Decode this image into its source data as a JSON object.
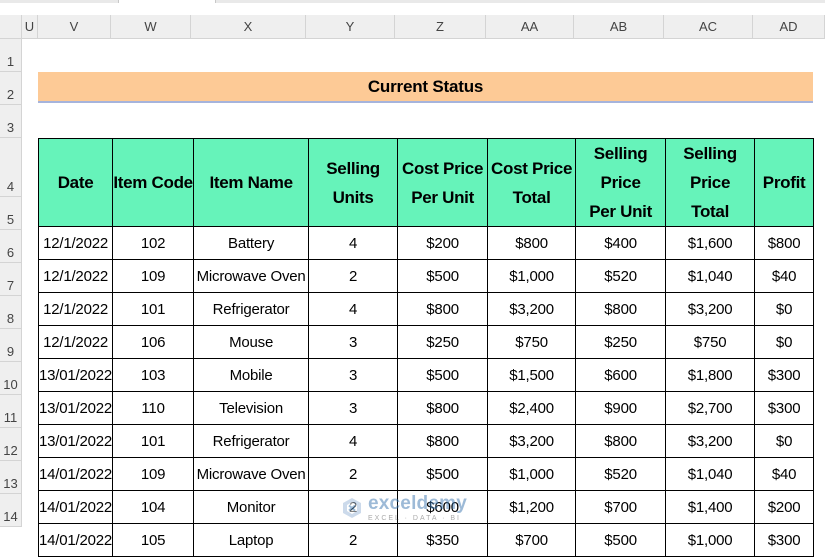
{
  "sheet": {
    "columns": [
      "U",
      "V",
      "W",
      "X",
      "Y",
      "Z",
      "AA",
      "AB",
      "AC",
      "AD"
    ],
    "rows": [
      "1",
      "2",
      "3",
      "4",
      "5",
      "6",
      "7",
      "8",
      "9",
      "10",
      "11",
      "12",
      "13",
      "14"
    ]
  },
  "title": "Current Status",
  "table": {
    "headers": [
      [
        "Date"
      ],
      [
        "Item Code"
      ],
      [
        "Item Name"
      ],
      [
        "Selling Units"
      ],
      [
        "Cost Price",
        "Per Unit"
      ],
      [
        "Cost Price",
        "Total"
      ],
      [
        "Selling Price",
        "Per Unit"
      ],
      [
        "Selling Price",
        "Total"
      ],
      [
        "Profit"
      ]
    ],
    "rows": [
      [
        "12/1/2022",
        "102",
        "Battery",
        "4",
        "$200",
        "$800",
        "$400",
        "$1,600",
        "$800"
      ],
      [
        "12/1/2022",
        "109",
        "Microwave Oven",
        "2",
        "$500",
        "$1,000",
        "$520",
        "$1,040",
        "$40"
      ],
      [
        "12/1/2022",
        "101",
        "Refrigerator",
        "4",
        "$800",
        "$3,200",
        "$800",
        "$3,200",
        "$0"
      ],
      [
        "12/1/2022",
        "106",
        "Mouse",
        "3",
        "$250",
        "$750",
        "$250",
        "$750",
        "$0"
      ],
      [
        "13/01/2022",
        "103",
        "Mobile",
        "3",
        "$500",
        "$1,500",
        "$600",
        "$1,800",
        "$300"
      ],
      [
        "13/01/2022",
        "110",
        "Television",
        "3",
        "$800",
        "$2,400",
        "$900",
        "$2,700",
        "$300"
      ],
      [
        "13/01/2022",
        "101",
        "Refrigerator",
        "4",
        "$800",
        "$3,200",
        "$800",
        "$3,200",
        "$0"
      ],
      [
        "14/01/2022",
        "109",
        "Microwave Oven",
        "2",
        "$500",
        "$1,000",
        "$520",
        "$1,040",
        "$40"
      ],
      [
        "14/01/2022",
        "104",
        "Monitor",
        "2",
        "$600",
        "$1,200",
        "$700",
        "$1,400",
        "$200"
      ],
      [
        "14/01/2022",
        "105",
        "Laptop",
        "2",
        "$350",
        "$700",
        "$500",
        "$1,000",
        "$300"
      ]
    ]
  },
  "watermark": {
    "brand": "exceldemy",
    "tagline": "EXCEL · DATA · BI",
    "icon": "exceldemy-logo-icon"
  },
  "colors": {
    "title_fill": "#fdca96",
    "header_fill": "#66f3ba",
    "title_underline": "#a6b4dc"
  }
}
